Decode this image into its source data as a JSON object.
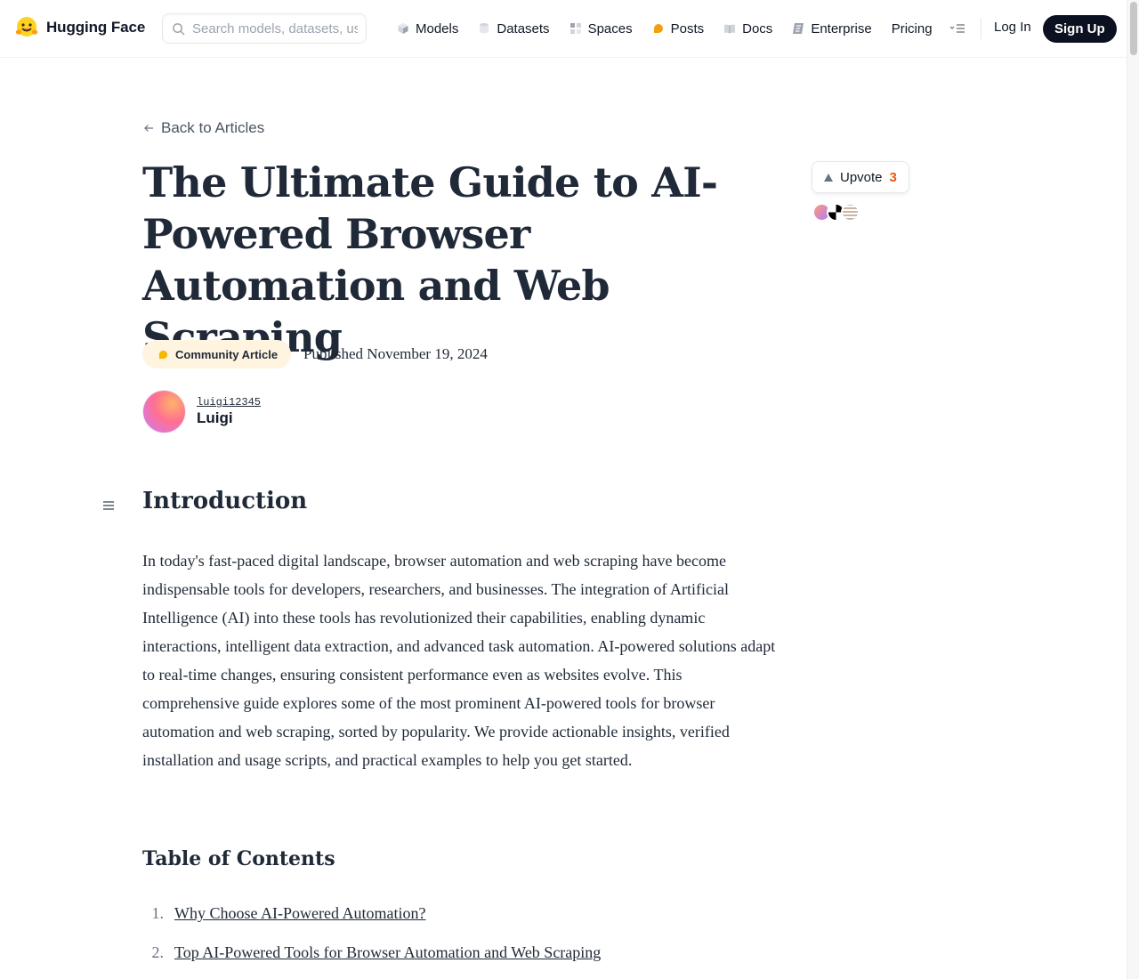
{
  "header": {
    "brand_name": "Hugging Face",
    "search_placeholder": "Search models, datasets, users...",
    "nav": [
      {
        "label": "Models",
        "icon": "cube-icon"
      },
      {
        "label": "Datasets",
        "icon": "database-icon"
      },
      {
        "label": "Spaces",
        "icon": "grid-icon"
      },
      {
        "label": "Posts",
        "icon": "chat-bubble-icon"
      },
      {
        "label": "Docs",
        "icon": "book-icon"
      },
      {
        "label": "Enterprise",
        "icon": "enterprise-icon"
      },
      {
        "label": "Pricing",
        "icon": ""
      }
    ],
    "login_label": "Log In",
    "signup_label": "Sign Up"
  },
  "article": {
    "back_label": "Back to Articles",
    "title": "The Ultimate Guide to AI-Powered Browser Automation and Web Scraping",
    "badge_label": "Community Article",
    "published": "Published November 19, 2024",
    "author": {
      "handle": "luigi12345",
      "name": "Luigi"
    },
    "upvote": {
      "label": "Upvote",
      "count": "3"
    },
    "intro_heading": "Introduction",
    "intro_text": "In today's fast-paced digital landscape, browser automation and web scraping have become indispensable tools for developers, researchers, and businesses. The integration of Artificial Intelligence (AI) into these tools has revolutionized their capabilities, enabling dynamic interactions, intelligent data extraction, and advanced task automation. AI-powered solutions adapt to real-time changes, ensuring consistent performance even as websites evolve. This comprehensive guide explores some of the most prominent AI-powered tools for browser automation and web scraping, sorted by popularity. We provide actionable insights, verified installation and usage scripts, and practical examples to help you get started.",
    "toc_heading": "Table of Contents",
    "toc": [
      {
        "num": "1.",
        "label": "Why Choose AI-Powered Automation?"
      },
      {
        "num": "2.",
        "label": "Top AI-Powered Tools for Browser Automation and Web Scraping"
      }
    ]
  },
  "colors": {
    "accent": "#ea580c",
    "brand_dark": "#0b1120",
    "badge_bg": "#fff4e0"
  }
}
